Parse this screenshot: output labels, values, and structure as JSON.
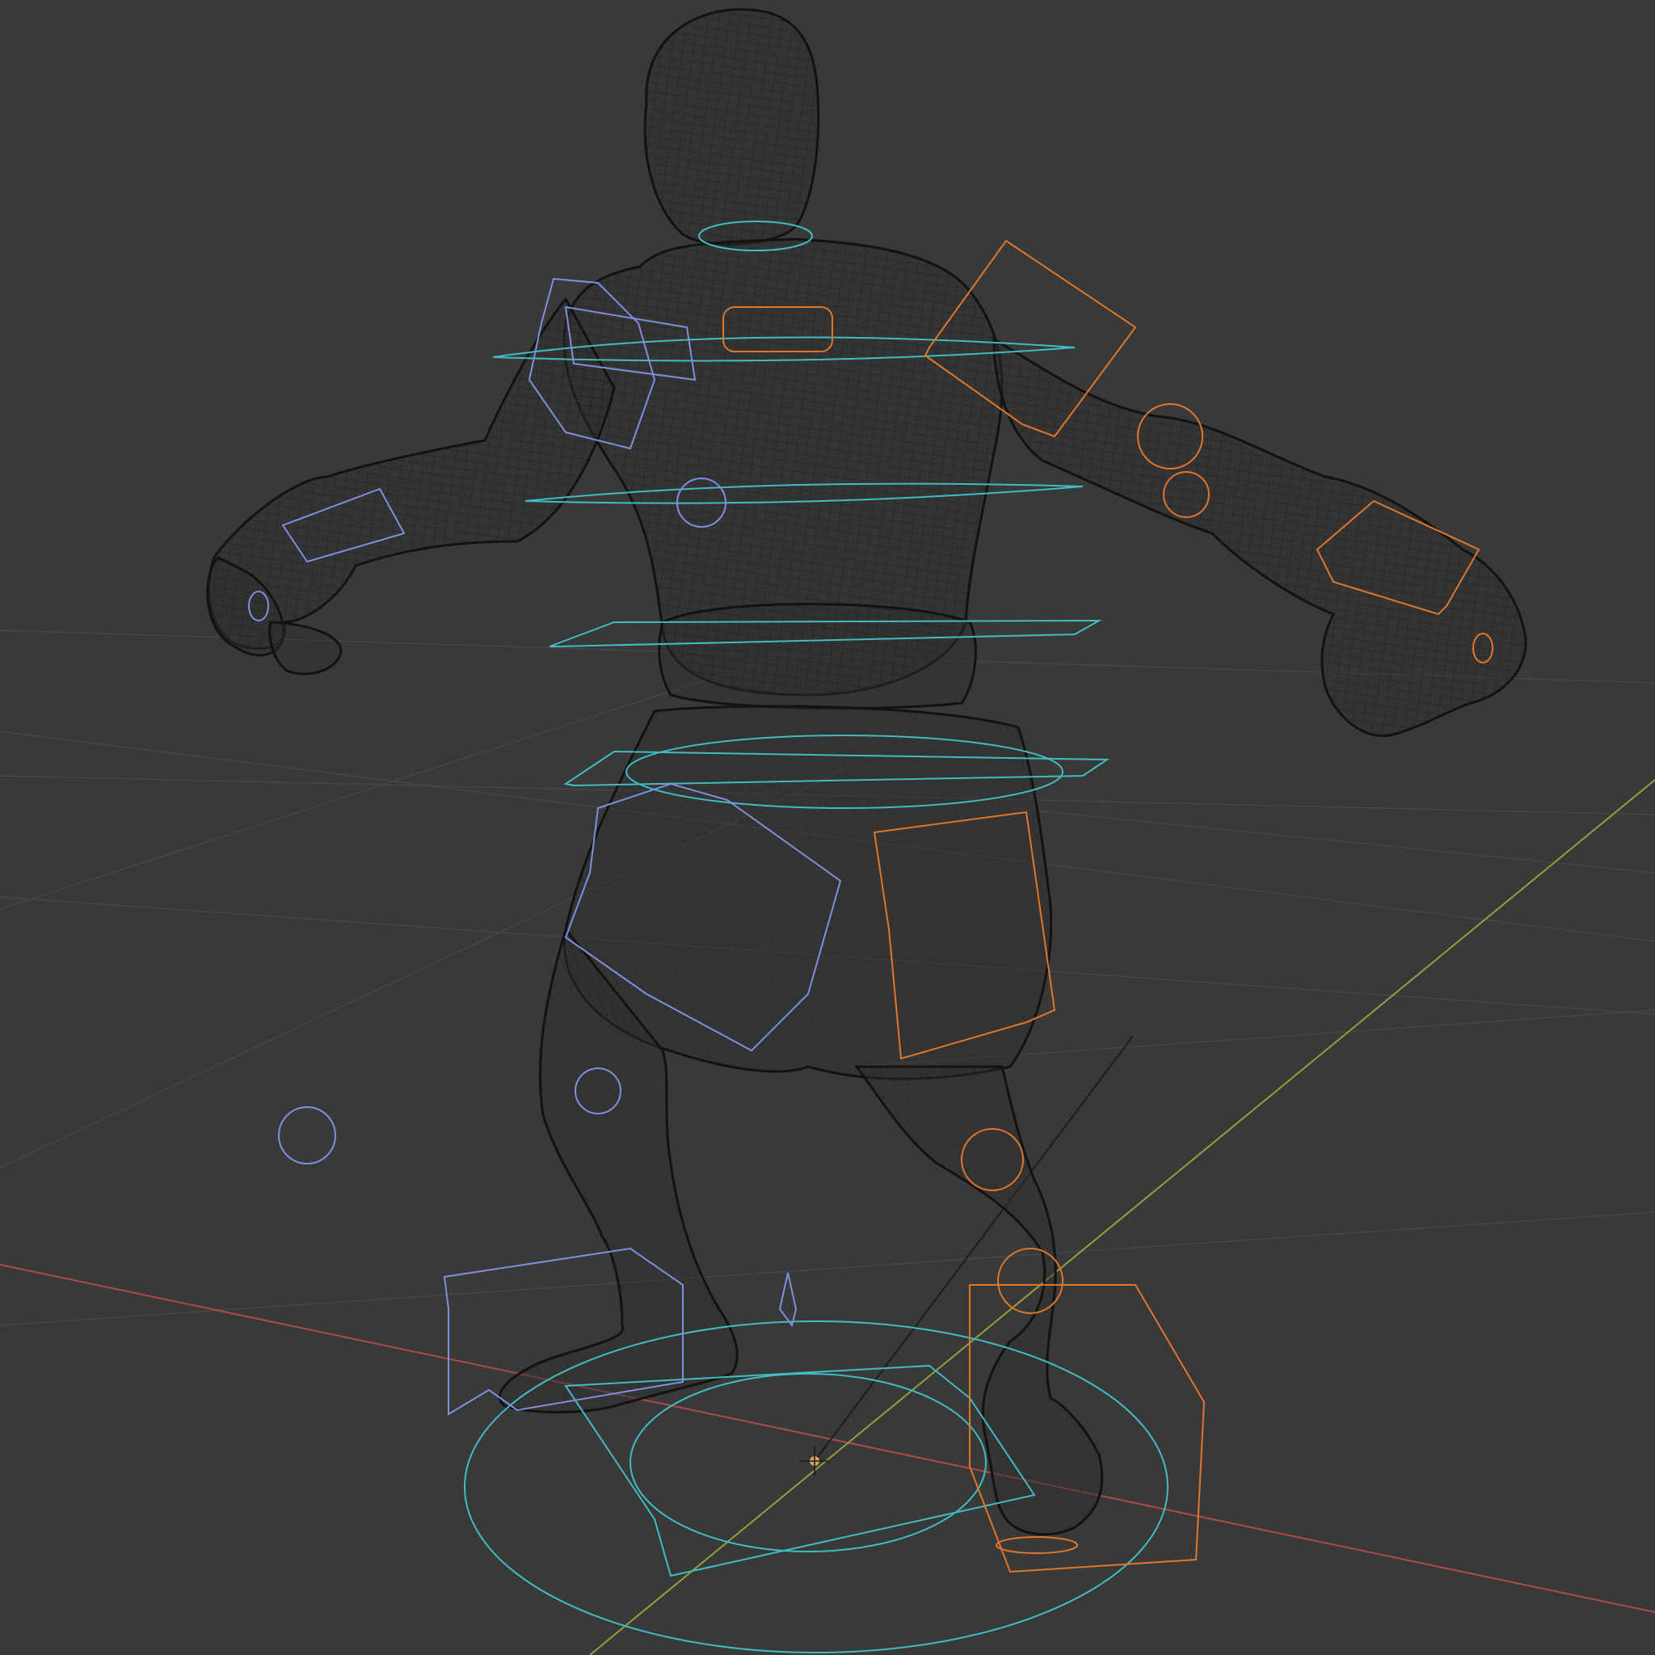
{
  "viewport": {
    "mode": "wireframe",
    "shading": "wireframe",
    "background_color": "#393939",
    "grid_visible": true,
    "grid_color": "#474747"
  },
  "axes": {
    "x_axis_color": "#b04a4a",
    "y_axis_color": "#8ea43a",
    "z_guide_color": "#1c1c1c"
  },
  "objects": {
    "mesh": {
      "icon": "character-mesh",
      "wire_color": "#141414"
    },
    "rig_controls": {
      "center_color": "#3fbdc3",
      "left_side_color": "#7f8fe0",
      "right_side_color": "#e0762c"
    },
    "origin_marker": {
      "icon": "object-origin-icon",
      "color": "#e0a060"
    }
  }
}
